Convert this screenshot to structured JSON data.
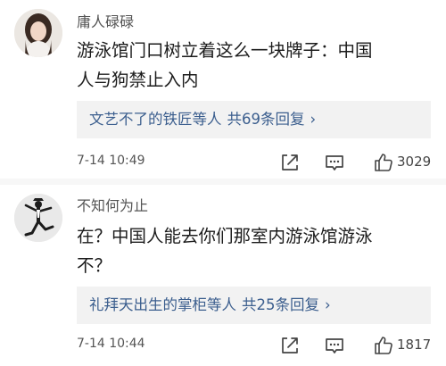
{
  "comments": [
    {
      "avatar_icon": "user-avatar-woman",
      "username": "庸人碌碌",
      "lines": [
        "游泳馆门口树立着这么一块牌子：中国",
        "人与狗禁止入内"
      ],
      "replies": {
        "who": "文艺不了的铁匠",
        "suffix": "等人",
        "count": "共69条回复",
        "chevron": "›"
      },
      "time": "7-14 10:49",
      "likes": "3029"
    },
    {
      "avatar_icon": "user-avatar-dancer",
      "username": "不知何为止",
      "lines": [
        "在？中国人能去你们那室内游泳馆游泳",
        "不？"
      ],
      "replies": {
        "who": "礼拜天出生的掌柜",
        "suffix": "等人",
        "count": "共25条回复",
        "chevron": "›"
      },
      "time": "7-14 10:44",
      "likes": "1817"
    }
  ],
  "icons": {
    "share": "share-icon",
    "reply": "comment-icon",
    "like": "thumbs-up-icon"
  },
  "colors": {
    "link": "#3b5e8e",
    "reply_box": "#f2f2f2",
    "meta_text": "#555555"
  }
}
